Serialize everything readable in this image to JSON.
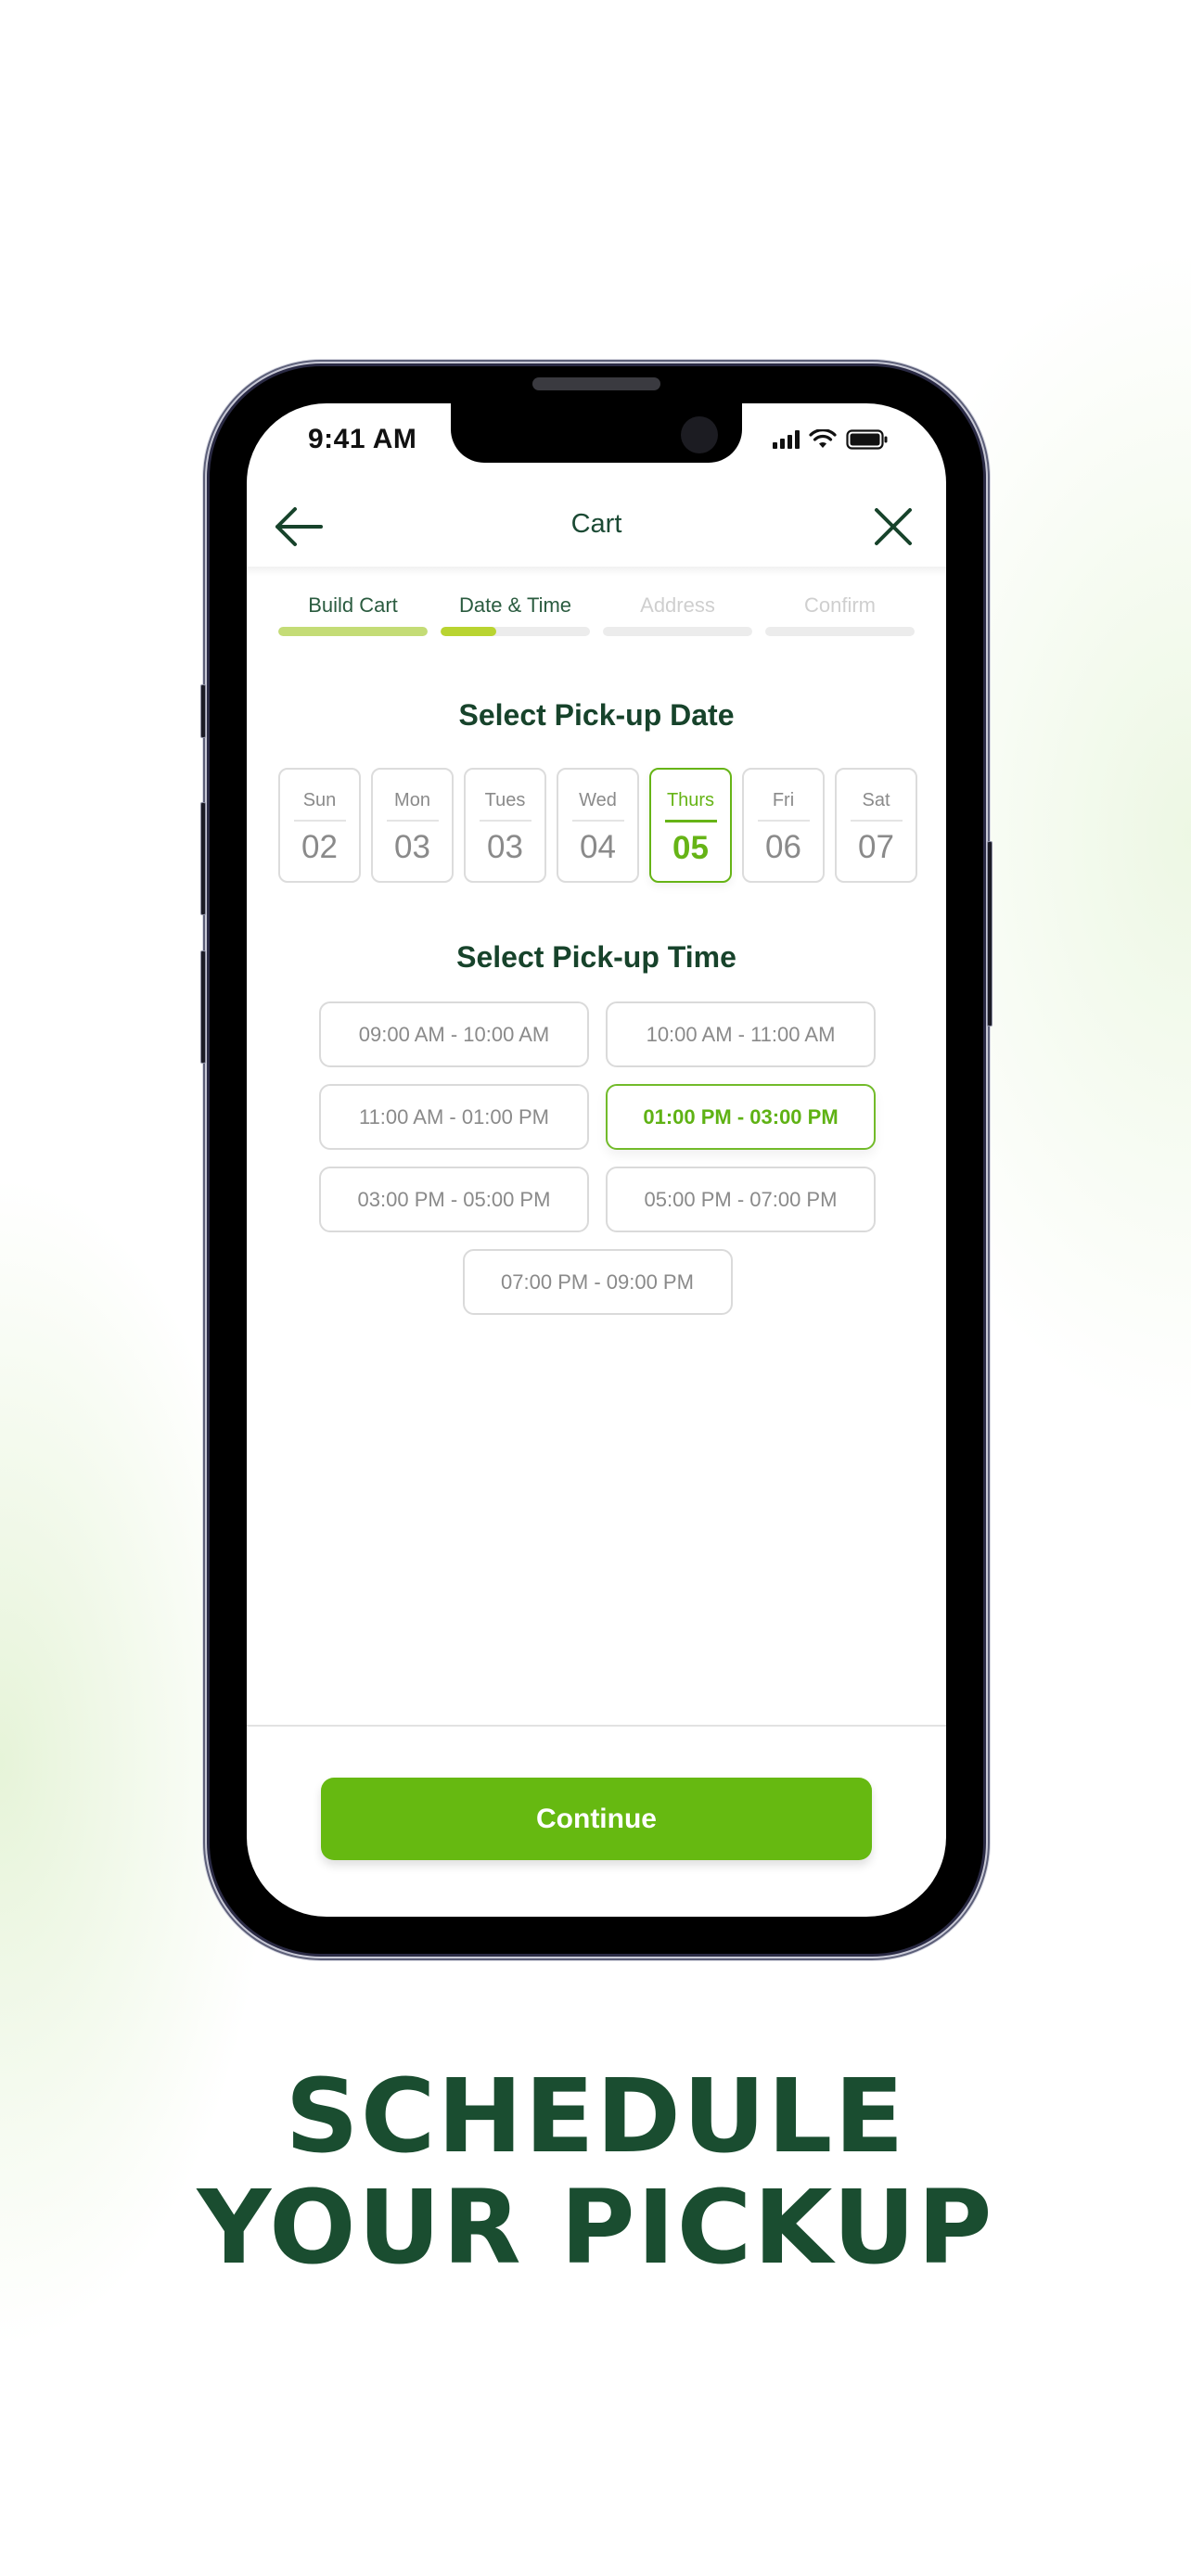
{
  "status_bar": {
    "time": "9:41 AM",
    "icons": [
      "cellular-signal-icon",
      "wifi-icon",
      "battery-icon"
    ]
  },
  "header": {
    "title": "Cart",
    "back_icon": "arrow-left-icon",
    "close_icon": "close-x-icon"
  },
  "stepper": {
    "steps": [
      {
        "label": "Build Cart",
        "state": "done",
        "progress": 1.0
      },
      {
        "label": "Date & Time",
        "state": "active",
        "progress": 0.37
      },
      {
        "label": "Address",
        "state": "todo",
        "progress": 0
      },
      {
        "label": "Confirm",
        "state": "todo",
        "progress": 0
      }
    ]
  },
  "date_section": {
    "title": "Select Pick-up Date",
    "dates": [
      {
        "day": "Sun",
        "num": "02",
        "selected": false
      },
      {
        "day": "Mon",
        "num": "03",
        "selected": false
      },
      {
        "day": "Tues",
        "num": "03",
        "selected": false
      },
      {
        "day": "Wed",
        "num": "04",
        "selected": false
      },
      {
        "day": "Thurs",
        "num": "05",
        "selected": true
      },
      {
        "day": "Fri",
        "num": "06",
        "selected": false
      },
      {
        "day": "Sat",
        "num": "07",
        "selected": false
      }
    ]
  },
  "time_section": {
    "title": "Select Pick-up Time",
    "slots": [
      {
        "label": "09:00 AM - 10:00 AM",
        "selected": false
      },
      {
        "label": "10:00 AM - 11:00 AM",
        "selected": false
      },
      {
        "label": "11:00 AM - 01:00 PM",
        "selected": false
      },
      {
        "label": "01:00 PM - 03:00 PM",
        "selected": true
      },
      {
        "label": "03:00 PM - 05:00 PM",
        "selected": false
      },
      {
        "label": "05:00 PM - 07:00 PM",
        "selected": false
      },
      {
        "label": "07:00 PM - 09:00 PM",
        "selected": false
      }
    ]
  },
  "footer": {
    "continue_label": "Continue"
  },
  "headline": {
    "line1": "SCHEDULE",
    "line2": "YOUR PICKUP"
  },
  "colors": {
    "brand_dark_green": "#1a4d30",
    "accent_green": "#66b911",
    "progress_done": "#c4dc76",
    "progress_active": "#b9d431"
  }
}
